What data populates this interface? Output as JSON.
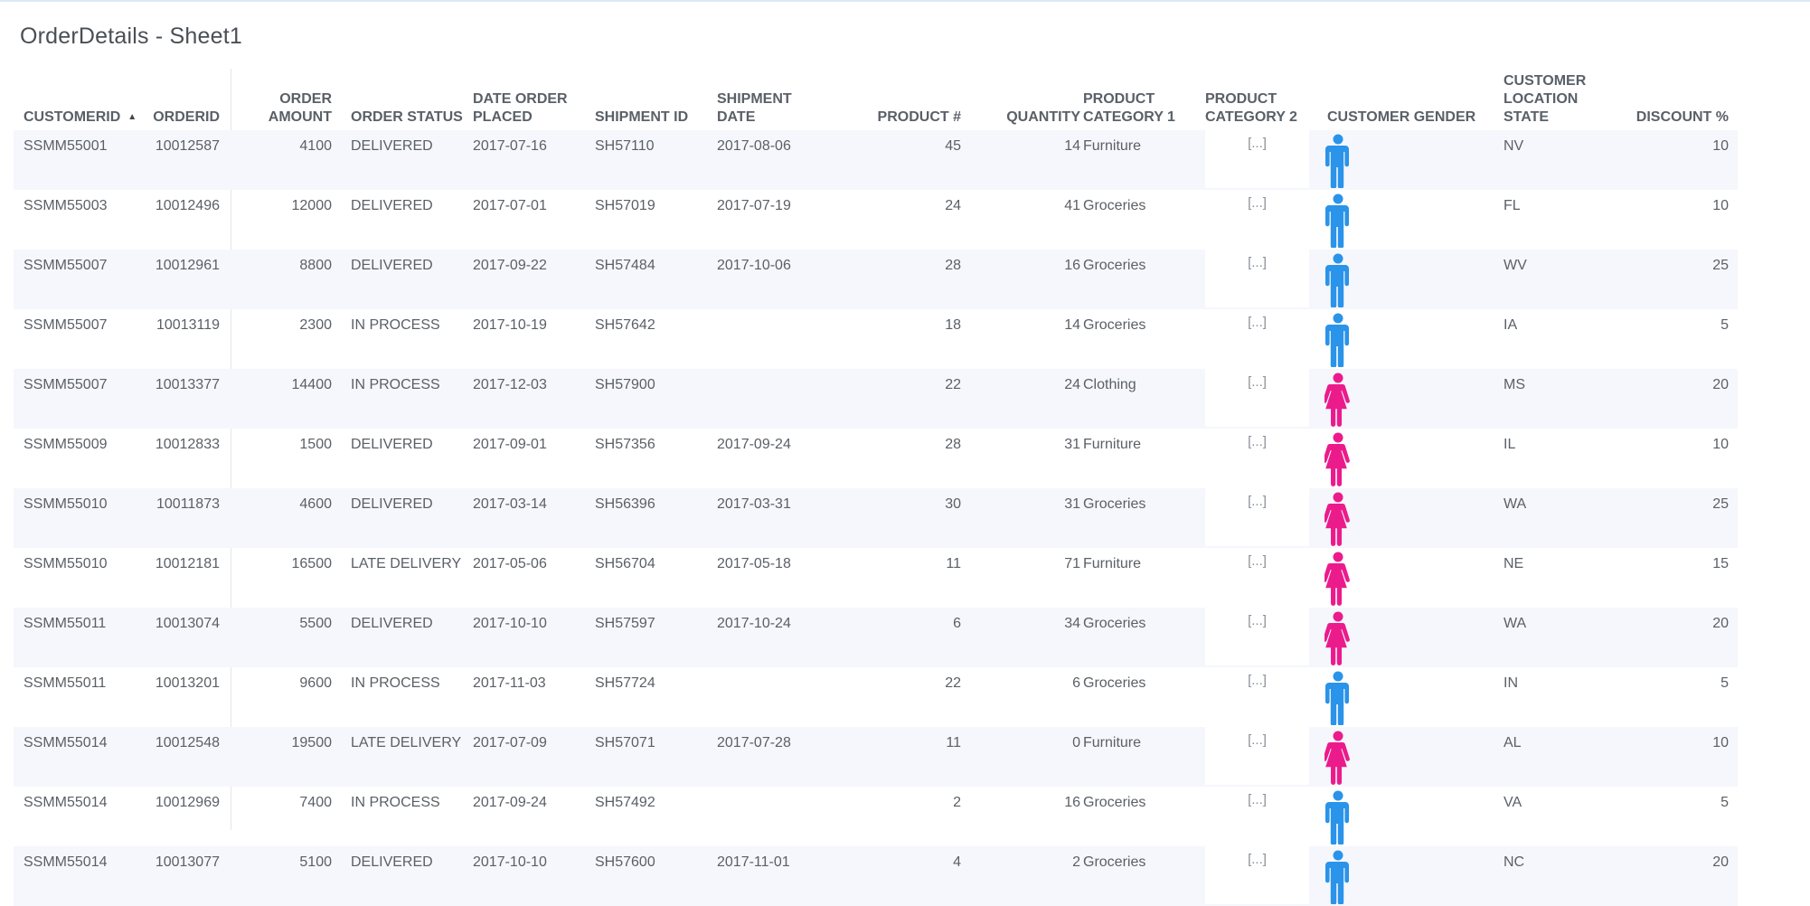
{
  "page": {
    "title": "OrderDetails - Sheet1"
  },
  "colors": {
    "male": "#2a93ea",
    "female": "#ec1b8c"
  },
  "columns": [
    {
      "key": "customerid",
      "label": "CUSTOMERID"
    },
    {
      "key": "orderid",
      "label": "ORDERID"
    },
    {
      "key": "order_amount",
      "label": "ORDER AMOUNT"
    },
    {
      "key": "order_status",
      "label": "ORDER STATUS"
    },
    {
      "key": "date_order_placed",
      "label": "DATE ORDER PLACED"
    },
    {
      "key": "shipment_id",
      "label": "SHIPMENT ID"
    },
    {
      "key": "shipment_date",
      "label": "SHIPMENT DATE"
    },
    {
      "key": "product_num",
      "label": "PRODUCT #"
    },
    {
      "key": "quantity",
      "label": "QUANTITY"
    },
    {
      "key": "product_category_1",
      "label": "PRODUCT CATEGORY 1"
    },
    {
      "key": "product_category_2",
      "label": "PRODUCT CATEGORY 2"
    },
    {
      "key": "customer_gender",
      "label": "CUSTOMER GENDER"
    },
    {
      "key": "customer_location_state",
      "label": "CUSTOMER LOCATION STATE"
    },
    {
      "key": "discount",
      "label": "DISCOUNT %"
    }
  ],
  "rows": [
    {
      "customerid": "SSMM55001",
      "orderid": "10012587",
      "order_amount": "4100",
      "order_status": "DELIVERED",
      "date_order_placed": "2017-07-16",
      "shipment_id": "SH57110",
      "shipment_date": "2017-08-06",
      "product_num": "45",
      "quantity": "14",
      "product_category_1": "Furniture",
      "product_category_2": "[...]",
      "customer_gender": "male-icon",
      "customer_location_state": "NV",
      "discount": "10"
    },
    {
      "customerid": "SSMM55003",
      "orderid": "10012496",
      "order_amount": "12000",
      "order_status": "DELIVERED",
      "date_order_placed": "2017-07-01",
      "shipment_id": "SH57019",
      "shipment_date": "2017-07-19",
      "product_num": "24",
      "quantity": "41",
      "product_category_1": "Groceries",
      "product_category_2": "[...]",
      "customer_gender": "male-icon",
      "customer_location_state": "FL",
      "discount": "10"
    },
    {
      "customerid": "SSMM55007",
      "orderid": "10012961",
      "order_amount": "8800",
      "order_status": "DELIVERED",
      "date_order_placed": "2017-09-22",
      "shipment_id": "SH57484",
      "shipment_date": "2017-10-06",
      "product_num": "28",
      "quantity": "16",
      "product_category_1": "Groceries",
      "product_category_2": "[...]",
      "customer_gender": "male-icon",
      "customer_location_state": "WV",
      "discount": "25"
    },
    {
      "customerid": "SSMM55007",
      "orderid": "10013119",
      "order_amount": "2300",
      "order_status": "IN PROCESS",
      "date_order_placed": "2017-10-19",
      "shipment_id": "SH57642",
      "shipment_date": "",
      "product_num": "18",
      "quantity": "14",
      "product_category_1": "Groceries",
      "product_category_2": "[...]",
      "customer_gender": "male-icon",
      "customer_location_state": "IA",
      "discount": "5"
    },
    {
      "customerid": "SSMM55007",
      "orderid": "10013377",
      "order_amount": "14400",
      "order_status": "IN PROCESS",
      "date_order_placed": "2017-12-03",
      "shipment_id": "SH57900",
      "shipment_date": "",
      "product_num": "22",
      "quantity": "24",
      "product_category_1": "Clothing",
      "product_category_2": "[...]",
      "customer_gender": "female-icon",
      "customer_location_state": "MS",
      "discount": "20"
    },
    {
      "customerid": "SSMM55009",
      "orderid": "10012833",
      "order_amount": "1500",
      "order_status": "DELIVERED",
      "date_order_placed": "2017-09-01",
      "shipment_id": "SH57356",
      "shipment_date": "2017-09-24",
      "product_num": "28",
      "quantity": "31",
      "product_category_1": "Furniture",
      "product_category_2": "[...]",
      "customer_gender": "female-icon",
      "customer_location_state": "IL",
      "discount": "10"
    },
    {
      "customerid": "SSMM55010",
      "orderid": "10011873",
      "order_amount": "4600",
      "order_status": "DELIVERED",
      "date_order_placed": "2017-03-14",
      "shipment_id": "SH56396",
      "shipment_date": "2017-03-31",
      "product_num": "30",
      "quantity": "31",
      "product_category_1": "Groceries",
      "product_category_2": "[...]",
      "customer_gender": "female-icon",
      "customer_location_state": "WA",
      "discount": "25"
    },
    {
      "customerid": "SSMM55010",
      "orderid": "10012181",
      "order_amount": "16500",
      "order_status": "LATE DELIVERY",
      "date_order_placed": "2017-05-06",
      "shipment_id": "SH56704",
      "shipment_date": "2017-05-18",
      "product_num": "11",
      "quantity": "71",
      "product_category_1": "Furniture",
      "product_category_2": "[...]",
      "customer_gender": "female-icon",
      "customer_location_state": "NE",
      "discount": "15"
    },
    {
      "customerid": "SSMM55011",
      "orderid": "10013074",
      "order_amount": "5500",
      "order_status": "DELIVERED",
      "date_order_placed": "2017-10-10",
      "shipment_id": "SH57597",
      "shipment_date": "2017-10-24",
      "product_num": "6",
      "quantity": "34",
      "product_category_1": "Groceries",
      "product_category_2": "[...]",
      "customer_gender": "female-icon",
      "customer_location_state": "WA",
      "discount": "20"
    },
    {
      "customerid": "SSMM55011",
      "orderid": "10013201",
      "order_amount": "9600",
      "order_status": "IN PROCESS",
      "date_order_placed": "2017-11-03",
      "shipment_id": "SH57724",
      "shipment_date": "",
      "product_num": "22",
      "quantity": "6",
      "product_category_1": "Groceries",
      "product_category_2": "[...]",
      "customer_gender": "male-icon",
      "customer_location_state": "IN",
      "discount": "5"
    },
    {
      "customerid": "SSMM55014",
      "orderid": "10012548",
      "order_amount": "19500",
      "order_status": "LATE DELIVERY",
      "date_order_placed": "2017-07-09",
      "shipment_id": "SH57071",
      "shipment_date": "2017-07-28",
      "product_num": "11",
      "quantity": "0",
      "product_category_1": "Furniture",
      "product_category_2": "[...]",
      "customer_gender": "female-icon",
      "customer_location_state": "AL",
      "discount": "10"
    },
    {
      "customerid": "SSMM55014",
      "orderid": "10012969",
      "order_amount": "7400",
      "order_status": "IN PROCESS",
      "date_order_placed": "2017-09-24",
      "shipment_id": "SH57492",
      "shipment_date": "",
      "product_num": "2",
      "quantity": "16",
      "product_category_1": "Groceries",
      "product_category_2": "[...]",
      "customer_gender": "male-icon",
      "customer_location_state": "VA",
      "discount": "5"
    },
    {
      "customerid": "SSMM55014",
      "orderid": "10013077",
      "order_amount": "5100",
      "order_status": "DELIVERED",
      "date_order_placed": "2017-10-10",
      "shipment_id": "SH57600",
      "shipment_date": "2017-11-01",
      "product_num": "4",
      "quantity": "2",
      "product_category_1": "Groceries",
      "product_category_2": "[...]",
      "customer_gender": "male-icon",
      "customer_location_state": "NC",
      "discount": "20"
    }
  ]
}
